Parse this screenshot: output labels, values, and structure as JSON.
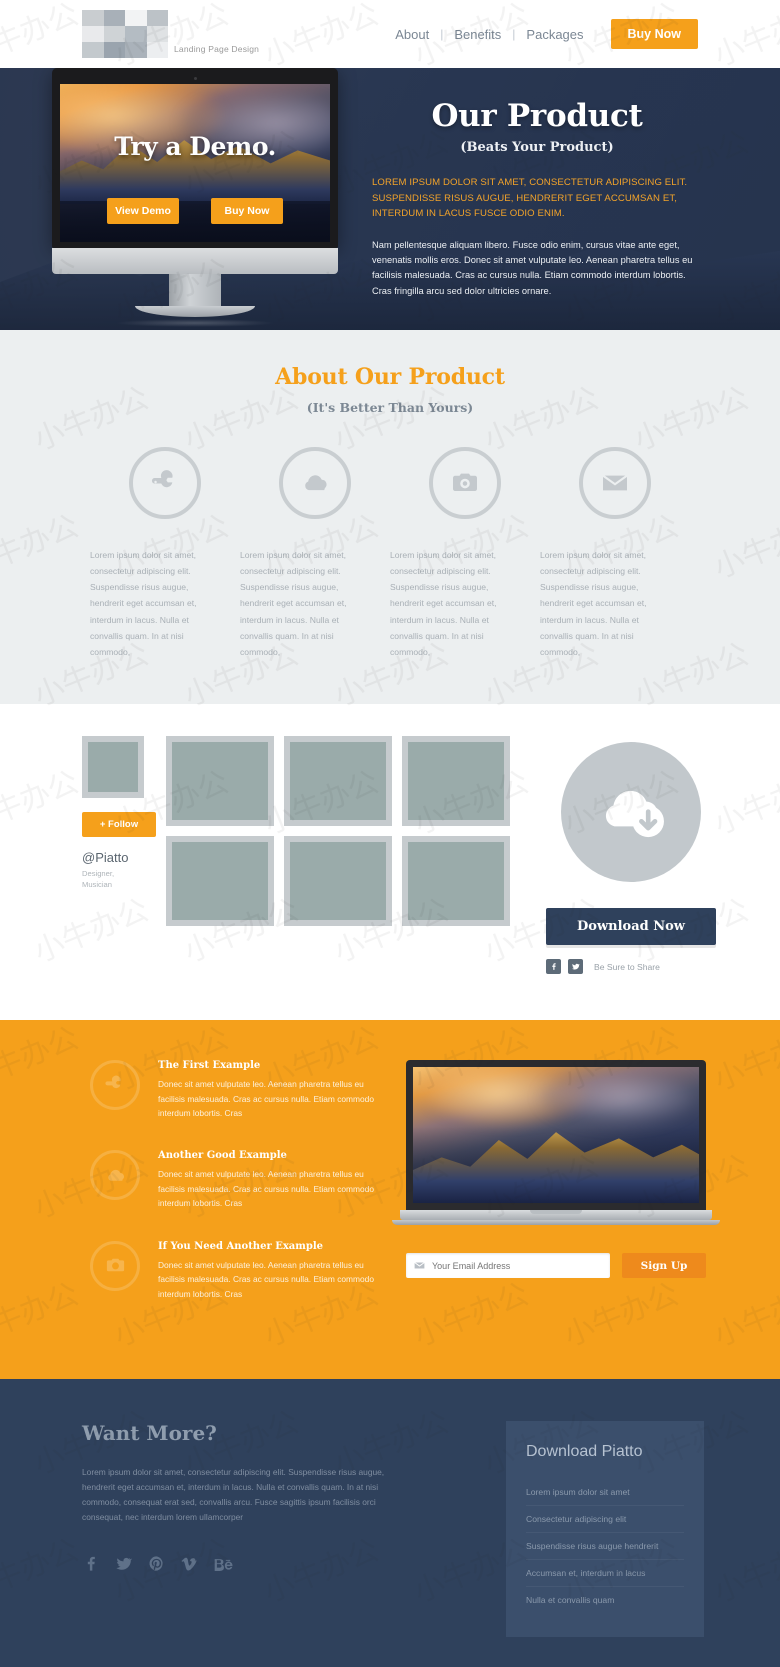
{
  "header": {
    "logo_tagline": "Landing Page Design",
    "logo_icon": "pixel-blocks-logo",
    "nav": [
      {
        "label": "About"
      },
      {
        "label": "Benefits"
      },
      {
        "label": "Packages"
      }
    ],
    "separator": "|",
    "buy_now_label": "Buy Now"
  },
  "hero": {
    "monitor": {
      "screen_title": "Try a Demo.",
      "buttons": [
        {
          "label": "View Demo"
        },
        {
          "label": "Buy Now"
        }
      ]
    },
    "title": "Our Product",
    "subtitle": "(Beats Your Product)",
    "lede": "LOREM IPSUM DOLOR SIT AMET, CONSECTETUR ADIPISCING ELIT. SUSPENDISSE RISUS AUGUE, HENDRERIT EGET ACCUMSAN ET, INTERDUM IN LACUS FUSCE ODIO ENIM.",
    "body": "Nam pellentesque aliquam libero. Fusce odio enim, cursus vitae ante eget, venenatis mollis eros. Donec sit amet vulputate leo. Aenean pharetra tellus eu facilisis malesuada. Cras ac cursus nulla. Etiam commodo interdum lobortis. Cras fringilla arcu sed dolor ultricies ornare."
  },
  "about": {
    "title": "About Our Product",
    "subtitle": "(It's Better Than Yours)",
    "features": [
      {
        "icon": "wrench-icon",
        "text": "Lorem ipsum dolor sit amet, consectetur adipiscing elit. Suspendisse risus augue, hendrerit eget accumsan et, interdum in lacus. Nulla et convallis quam. In at nisi commodo,"
      },
      {
        "icon": "cloud-icon",
        "text": "Lorem ipsum dolor sit amet, consectetur adipiscing elit. Suspendisse risus augue, hendrerit eget accumsan et, interdum in lacus. Nulla et convallis quam. In at nisi commodo,"
      },
      {
        "icon": "camera-icon",
        "text": "Lorem ipsum dolor sit amet, consectetur adipiscing elit. Suspendisse risus augue, hendrerit eget accumsan et, interdum in lacus. Nulla et convallis quam. In at nisi commodo,"
      },
      {
        "icon": "envelope-icon",
        "text": "Lorem ipsum dolor sit amet, consectetur adipiscing elit. Suspendisse risus augue, hendrerit eget accumsan et, interdum in lacus. Nulla et convallis quam. In at nisi commodo,"
      }
    ]
  },
  "gallery": {
    "profile": {
      "avatar": "profile-avatar-placeholder",
      "follow_label": "+ Follow",
      "handle": "@Piatto",
      "role_line1": "Designer,",
      "role_line2": "Musician"
    },
    "tiles_count": 6,
    "download": {
      "icon": "cloud-download-icon",
      "button_label": "Download Now",
      "share_label": "Be Sure to Share",
      "share_icons": [
        {
          "name": "facebook-icon",
          "glyph": "f"
        },
        {
          "name": "twitter-icon",
          "glyph": "t"
        }
      ]
    }
  },
  "benefits": {
    "items": [
      {
        "icon": "wrench-icon",
        "title": "The First Example",
        "text": "Donec sit amet vulputate leo. Aenean pharetra tellus eu facilisis malesuada. Cras ac cursus nulla. Etiam commodo interdum lobortis. Cras"
      },
      {
        "icon": "cloud-icon",
        "title": "Another Good Example",
        "text": "Donec sit amet vulputate leo. Aenean pharetra tellus eu facilisis malesuada. Cras ac cursus nulla. Etiam commodo interdum lobortis. Cras"
      },
      {
        "icon": "camera-icon",
        "title": "If You Need Another Example",
        "text": "Donec sit amet vulputate leo. Aenean pharetra tellus eu facilisis malesuada. Cras ac cursus nulla. Etiam commodo interdum lobortis. Cras"
      }
    ],
    "signup": {
      "email_placeholder": "Your Email Address",
      "email_value": "",
      "email_icon": "envelope-icon",
      "button_label": "Sign Up"
    }
  },
  "footer": {
    "title": "Want More?",
    "text": "Lorem ipsum dolor sit amet, consectetur adipiscing elit. Suspendisse risus augue, hendrerit eget accumsan et, interdum in lacus. Nulla et convallis quam. In at nisi commodo, consequat erat sed, convallis arcu. Fusce sagittis ipsum facilisis orci consequat, nec interdum lorem ullamcorper",
    "social": [
      {
        "name": "facebook-icon"
      },
      {
        "name": "twitter-icon"
      },
      {
        "name": "pinterest-icon"
      },
      {
        "name": "vimeo-icon"
      },
      {
        "name": "behance-icon"
      }
    ],
    "panel": {
      "title": "Download Piatto",
      "links": [
        {
          "label": "Lorem ipsum dolor sit amet"
        },
        {
          "label": "Consectetur adipiscing elit"
        },
        {
          "label": "Suspendisse risus augue hendrerit"
        },
        {
          "label": "Accumsan et, interdum in lacus"
        },
        {
          "label": "Nulla et convallis quam"
        }
      ]
    }
  },
  "colors": {
    "accent_orange": "#f5a01b",
    "deep_blue": "#2f415c",
    "panel_blue": "#3b4f6c",
    "light_gray": "#eceff0",
    "placeholder_gray": "#c6cbce"
  },
  "watermark": {
    "text": "小牛办公"
  }
}
